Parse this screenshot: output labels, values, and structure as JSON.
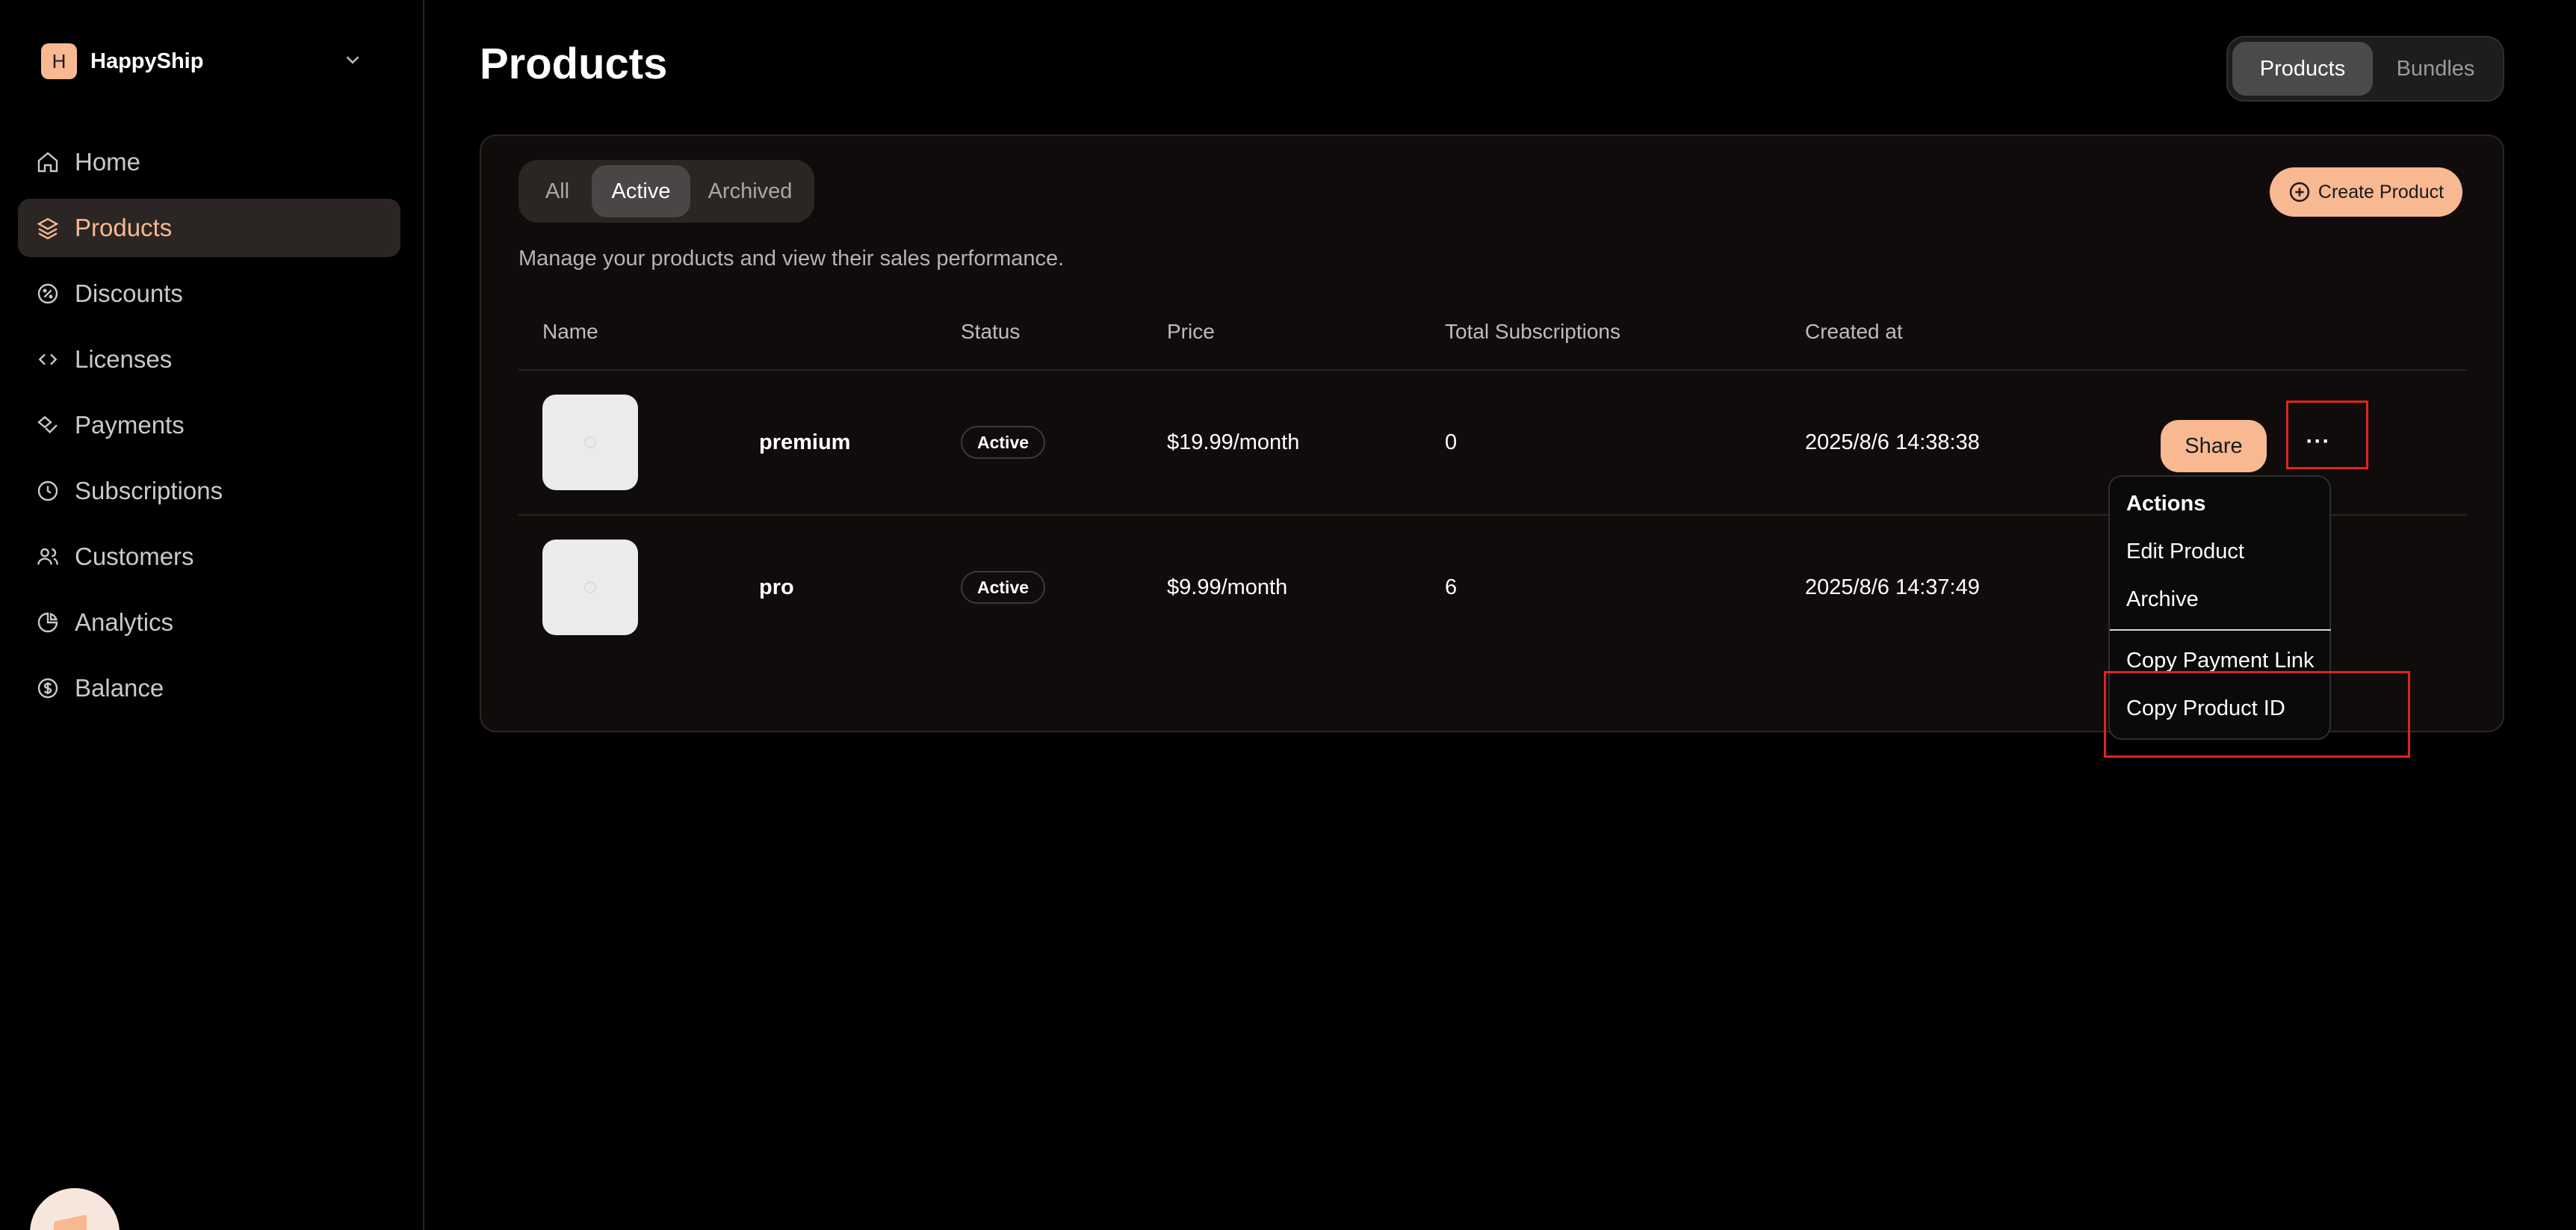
{
  "sidebar": {
    "org": {
      "initial": "H",
      "name": "HappyShip"
    },
    "items": [
      {
        "label": "Home",
        "icon": "home-icon",
        "active": false
      },
      {
        "label": "Products",
        "icon": "layers-icon",
        "active": true
      },
      {
        "label": "Discounts",
        "icon": "discount-icon",
        "active": false
      },
      {
        "label": "Licenses",
        "icon": "code-icon",
        "active": false
      },
      {
        "label": "Payments",
        "icon": "payments-icon",
        "active": false
      },
      {
        "label": "Subscriptions",
        "icon": "clock-icon",
        "active": false
      },
      {
        "label": "Customers",
        "icon": "users-icon",
        "active": false
      },
      {
        "label": "Analytics",
        "icon": "pie-chart-icon",
        "active": false
      },
      {
        "label": "Balance",
        "icon": "dollar-circle-icon",
        "active": false
      }
    ]
  },
  "header": {
    "title": "Products",
    "view_switch": [
      "Products",
      "Bundles"
    ],
    "active_view": "Products"
  },
  "filters": {
    "options": [
      "All",
      "Active",
      "Archived"
    ],
    "selected": "Active"
  },
  "create_label": "Create Product",
  "description": "Manage your products and view their sales performance.",
  "table": {
    "columns": [
      "Name",
      "Status",
      "Price",
      "Total Subscriptions",
      "Created at"
    ],
    "rows": [
      {
        "name": "premium",
        "status": "Active",
        "price": "$19.99/month",
        "subscriptions": "0",
        "created": "2025/8/6 14:38:38"
      },
      {
        "name": "pro",
        "status": "Active",
        "price": "$9.99/month",
        "subscriptions": "6",
        "created": "2025/8/6 14:37:49"
      }
    ]
  },
  "row_actions": {
    "share_label": "Share",
    "more_label": "···"
  },
  "menu": {
    "title": "Actions",
    "items": [
      "Edit Product",
      "Archive",
      "Copy Payment Link",
      "Copy Product ID"
    ]
  },
  "colors": {
    "accent": "#f8b892",
    "highlight": "#e0241b",
    "background": "#000000"
  }
}
